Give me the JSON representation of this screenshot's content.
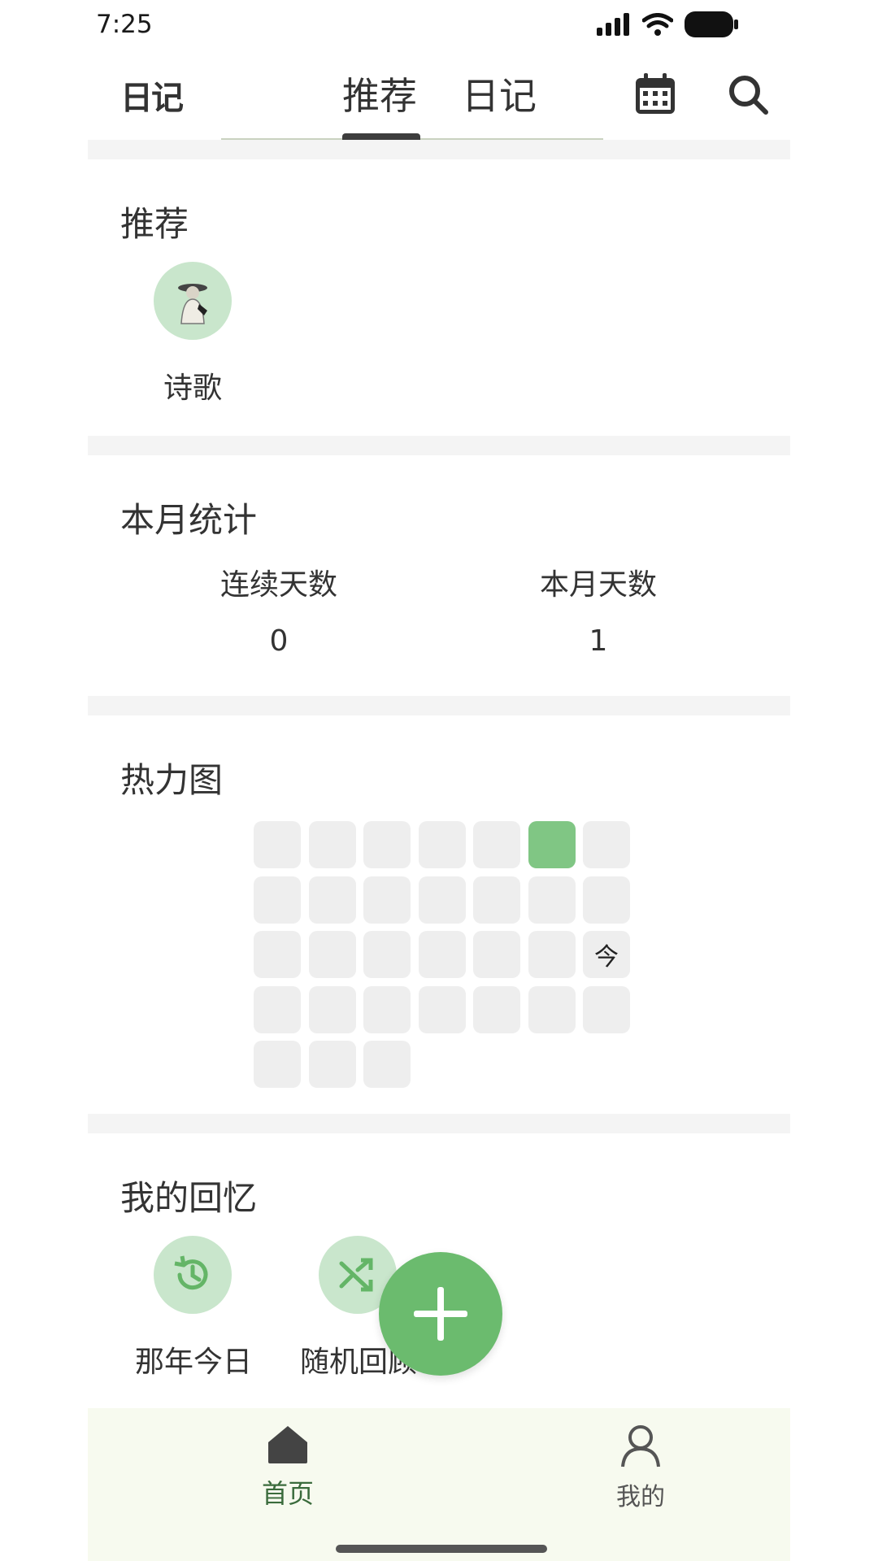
{
  "status_bar": {
    "time": "7:25"
  },
  "header": {
    "logo": "日记",
    "tabs": [
      {
        "label": "推荐",
        "selected": true
      },
      {
        "label": "日记",
        "selected": false
      }
    ],
    "icons": [
      "calendar-icon",
      "search-icon"
    ]
  },
  "recommend": {
    "title": "推荐",
    "items": [
      {
        "label": "诗歌",
        "icon": "poet-avatar-image"
      }
    ]
  },
  "monthly_stats": {
    "title": "本月统计",
    "streak_label": "连续天数",
    "streak_value": "0",
    "month_days_label": "本月天数",
    "month_days_value": "1"
  },
  "heatmap": {
    "title": "热力图",
    "today_label": "今",
    "cells": [
      0,
      0,
      0,
      0,
      0,
      1,
      0,
      0,
      0,
      0,
      0,
      0,
      0,
      0,
      0,
      0,
      0,
      0,
      0,
      0,
      "today",
      0,
      0,
      0,
      0,
      0,
      0,
      0,
      0,
      0,
      0
    ],
    "active_color": "#80c684",
    "empty_color": "#eeeeee"
  },
  "memories": {
    "title": "我的回忆",
    "items": [
      {
        "label": "那年今日",
        "icon": "history-icon"
      },
      {
        "label": "随机回顾",
        "icon": "shuffle-icon"
      }
    ]
  },
  "fab": {
    "icon": "plus-icon",
    "color": "#6bbb6e"
  },
  "bottom_nav": {
    "items": [
      {
        "label": "首页",
        "icon": "home-icon",
        "active": true
      },
      {
        "label": "我的",
        "icon": "person-icon",
        "active": false
      }
    ]
  },
  "colors": {
    "accent": "#6bbb6e",
    "accent_light": "#c9e6cc",
    "nav_bg": "#f7faef"
  }
}
